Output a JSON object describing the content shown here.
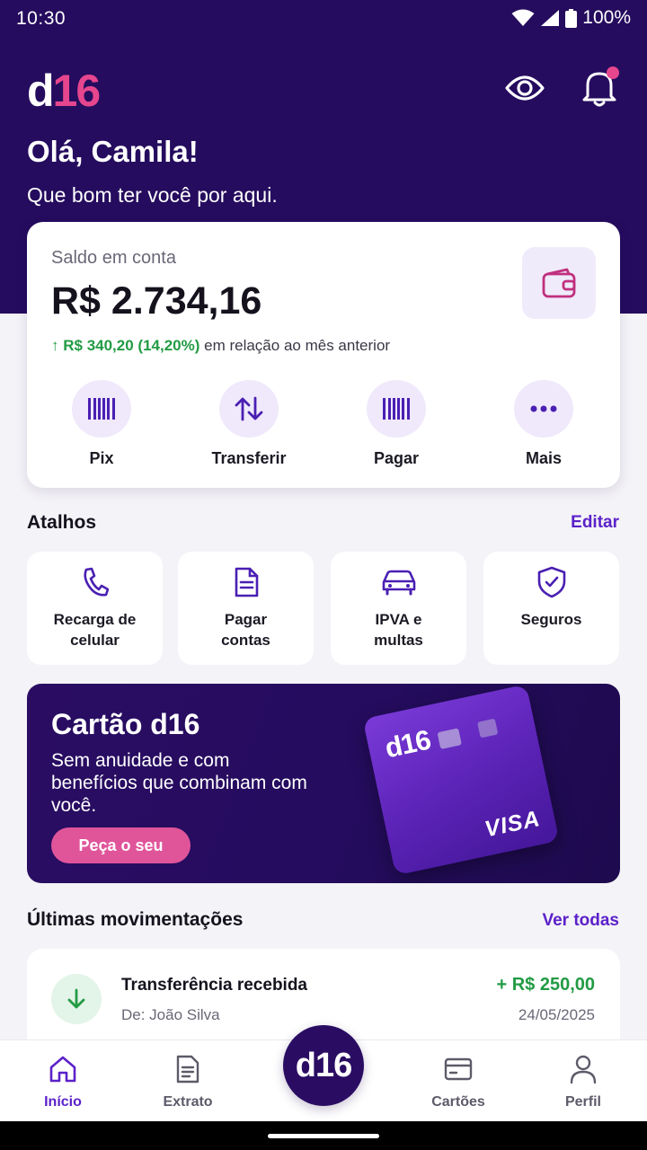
{
  "status_bar": {
    "time": "10:30",
    "battery": "100%"
  },
  "header": {
    "logo_letter": "d",
    "logo_number": "16",
    "greeting": "Olá, Camila!",
    "subtitle": "Que bom ter você por aqui."
  },
  "balance": {
    "label": "Saldo em conta",
    "value": "R$ 2.734,16",
    "variation": "R$ 340,20 (14,20%)",
    "variation_text": "em relação ao mês anterior",
    "actions": [
      {
        "label": "Pix",
        "icon": "barcode-icon"
      },
      {
        "label": "Transferir",
        "icon": "transfer-arrows-icon"
      },
      {
        "label": "Pagar",
        "icon": "barcode-icon"
      },
      {
        "label": "Mais",
        "icon": "more-dots-icon"
      }
    ]
  },
  "shortcuts": {
    "title": "Atalhos",
    "edit_label": "Editar",
    "items": [
      {
        "label_line1": "Recarga de",
        "label_line2": "celular",
        "icon": "phone-icon"
      },
      {
        "label_line1": "Pagar",
        "label_line2": "contas",
        "icon": "document-icon"
      },
      {
        "label_line1": "IPVA e",
        "label_line2": "multas",
        "icon": "car-icon"
      },
      {
        "label_line1": "Seguros",
        "label_line2": "",
        "icon": "shield-check-icon"
      }
    ]
  },
  "promo": {
    "title": "Cartão d16",
    "text": "Sem anuidade e com benefícios que combinam com você.",
    "button": "Peça o seu",
    "card_logo": "d16",
    "card_brand": "VISA"
  },
  "transactions": {
    "title": "Últimas movimentações",
    "see_all": "Ver todas",
    "items": [
      {
        "title": "Transferência recebida",
        "subtitle": "De: João Silva",
        "amount": "+ R$ 250,00",
        "date": "24/05/2025"
      }
    ]
  },
  "bottom_nav": {
    "items": [
      {
        "label": "Início",
        "icon": "home-icon",
        "active": true
      },
      {
        "label": "Extrato",
        "icon": "statement-icon",
        "active": false
      },
      {
        "label": "Cartões",
        "icon": "card-icon",
        "active": false
      },
      {
        "label": "Perfil",
        "icon": "user-icon",
        "active": false
      }
    ],
    "center_logo": "d16"
  },
  "colors": {
    "brand_purple": "#250c5e",
    "accent_pink": "#e5468e",
    "link_purple": "#5b21c9",
    "positive_green": "#229b44"
  }
}
